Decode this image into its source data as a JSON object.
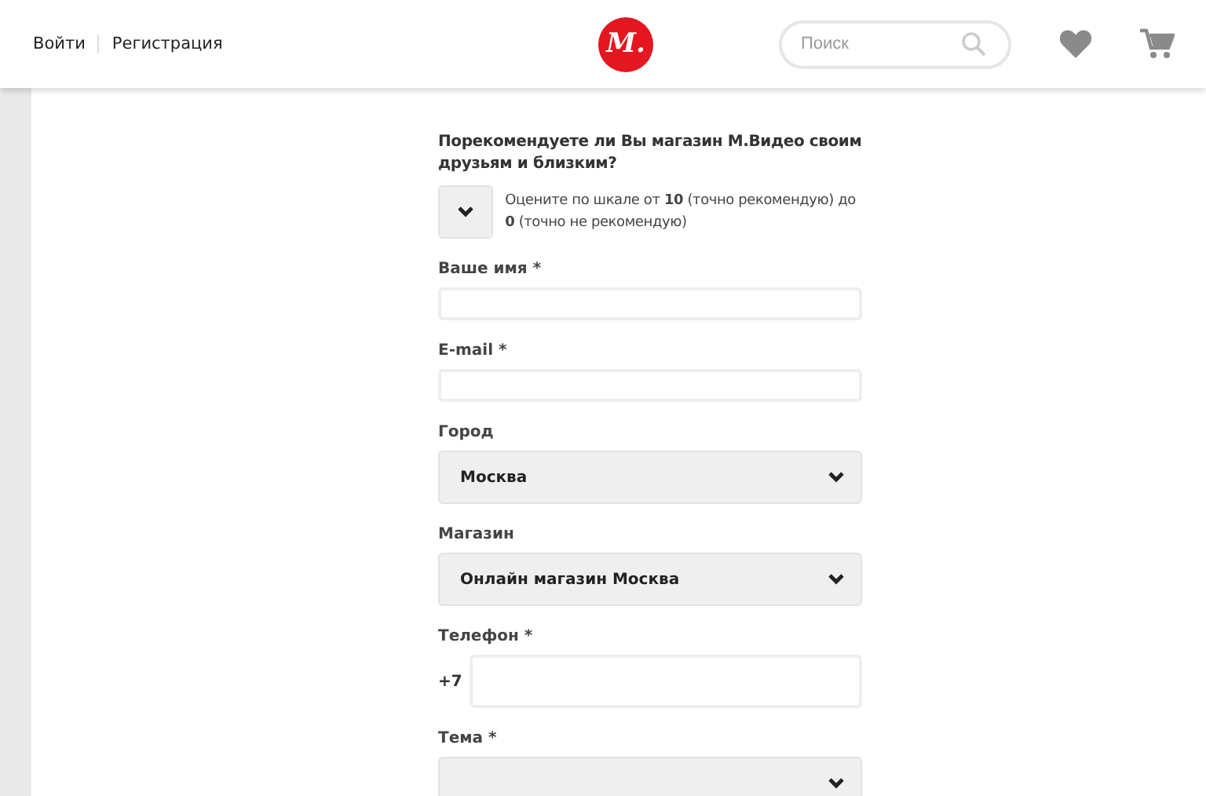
{
  "header": {
    "links": [
      "Войти",
      "Регистрация"
    ],
    "logo": "М.",
    "search": {
      "placeholder": "Поиск"
    }
  },
  "form": {
    "question": "Порекомендуете ли Вы магазин М.Видео своим друзьям и близким?",
    "rating_note": "Оцените по шкале от **10** (точно рекомендую) до **0** (точно не рекомендую)",
    "fields": [
      {
        "kind": "text",
        "label": "Ваше имя *"
      },
      {
        "kind": "text",
        "label": "E-mail *"
      },
      {
        "kind": "select",
        "label": "Город",
        "value": "Москва"
      },
      {
        "kind": "select",
        "label": "Магазин",
        "value": "Онлайн магазин Москва"
      },
      {
        "kind": "phone",
        "label": "Телефон *",
        "prefix": "+7"
      },
      {
        "kind": "select",
        "label": "Тема *"
      }
    ]
  }
}
